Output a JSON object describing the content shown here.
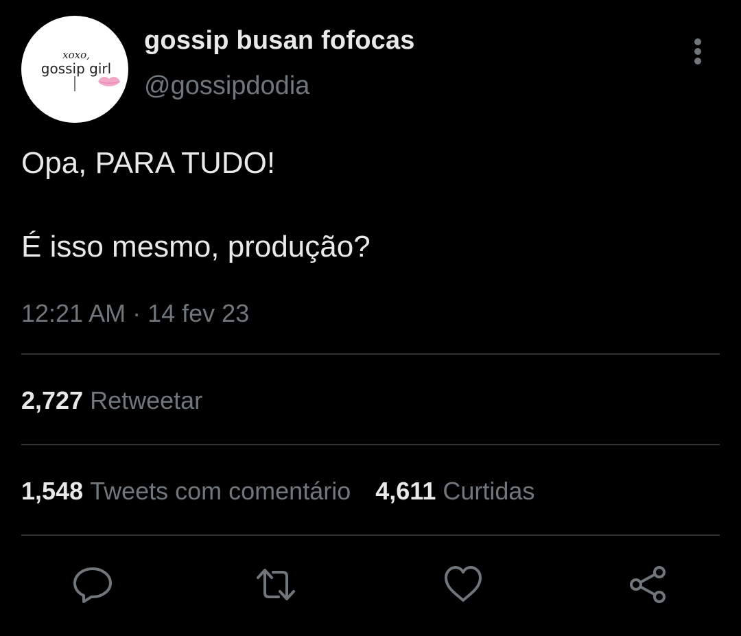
{
  "author": {
    "display_name": "gossip busan fofocas",
    "handle": "@gossipdodia",
    "avatar": {
      "top_text": "xoxo,",
      "main_text": "gossip girl"
    }
  },
  "tweet": {
    "line1": "Opa, PARA TUDO!",
    "line2": "É isso mesmo, produção?",
    "timestamp": "12:21 AM · 14 fev 23"
  },
  "stats": {
    "retweets": {
      "count": "2,727",
      "label": "Retweetar"
    },
    "quotes": {
      "count": "1,548",
      "label": "Tweets com comentário"
    },
    "likes": {
      "count": "4,611",
      "label": "Curtidas"
    }
  },
  "actions": {
    "reply_icon": "reply-icon",
    "retweet_icon": "retweet-icon",
    "like_icon": "heart-icon",
    "share_icon": "share-icon",
    "more_icon": "more-vertical-icon"
  },
  "colors": {
    "background": "#000000",
    "primary_text": "#e7e9ea",
    "secondary_text": "#71767b",
    "divider": "#2f3336",
    "icon": "#71767b",
    "lipstick": "#f2a6c8"
  }
}
